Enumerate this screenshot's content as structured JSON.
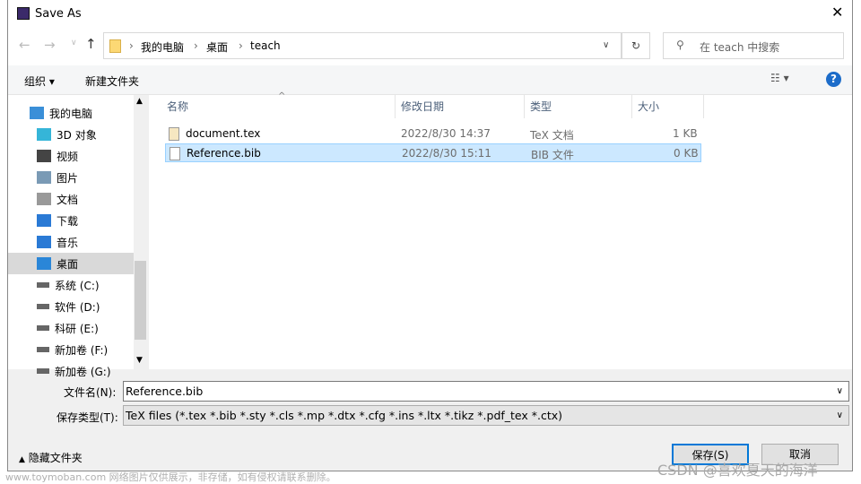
{
  "window": {
    "title": "Save As"
  },
  "nav": {
    "breadcrumb": [
      "我的电脑",
      "桌面",
      "teach"
    ],
    "search_placeholder": "在 teach 中搜索"
  },
  "toolbar": {
    "organize": "组织",
    "new_folder": "新建文件夹"
  },
  "sidebar": {
    "items": [
      {
        "label": "我的电脑",
        "icon": "computer-icon"
      },
      {
        "label": "3D 对象",
        "icon": "cube-icon"
      },
      {
        "label": "视频",
        "icon": "video-icon"
      },
      {
        "label": "图片",
        "icon": "picture-icon"
      },
      {
        "label": "文档",
        "icon": "document-icon"
      },
      {
        "label": "下载",
        "icon": "download-icon"
      },
      {
        "label": "音乐",
        "icon": "music-icon"
      },
      {
        "label": "桌面",
        "icon": "desktop-icon",
        "selected": true
      },
      {
        "label": "系统 (C:)",
        "icon": "drive-icon"
      },
      {
        "label": "软件 (D:)",
        "icon": "drive-icon"
      },
      {
        "label": "科研 (E:)",
        "icon": "drive-icon"
      },
      {
        "label": "新加卷 (F:)",
        "icon": "drive-icon"
      },
      {
        "label": "新加卷 (G:)",
        "icon": "drive-icon"
      }
    ]
  },
  "columns": [
    "名称",
    "修改日期",
    "类型",
    "大小"
  ],
  "files": [
    {
      "name": "document.tex",
      "date": "2022/8/30 14:37",
      "type": "TeX 文档",
      "size": "1 KB",
      "icon": "tex-file-icon"
    },
    {
      "name": "Reference.bib",
      "date": "2022/8/30 15:11",
      "type": "BIB 文件",
      "size": "0 KB",
      "icon": "blank-file-icon",
      "selected": true
    }
  ],
  "form": {
    "filename_label": "文件名(N):",
    "filename_value": "Reference.bib",
    "type_label": "保存类型(T):",
    "type_value": "TeX files (*.tex *.bib *.sty *.cls *.mp *.dtx *.cfg *.ins *.ltx *.tikz *.pdf_tex *.ctx)"
  },
  "footer": {
    "hide_folders": "隐藏文件夹",
    "save": "保存(S)",
    "cancel": "取消"
  },
  "watermark": {
    "left": "www.toymoban.com 网络图片仅供展示，非存储，如有侵权请联系删除。",
    "right": "CSDN @喜欢夏天的海洋"
  },
  "colors": {
    "selection": "#cce8ff",
    "accent": "#0078d7"
  }
}
